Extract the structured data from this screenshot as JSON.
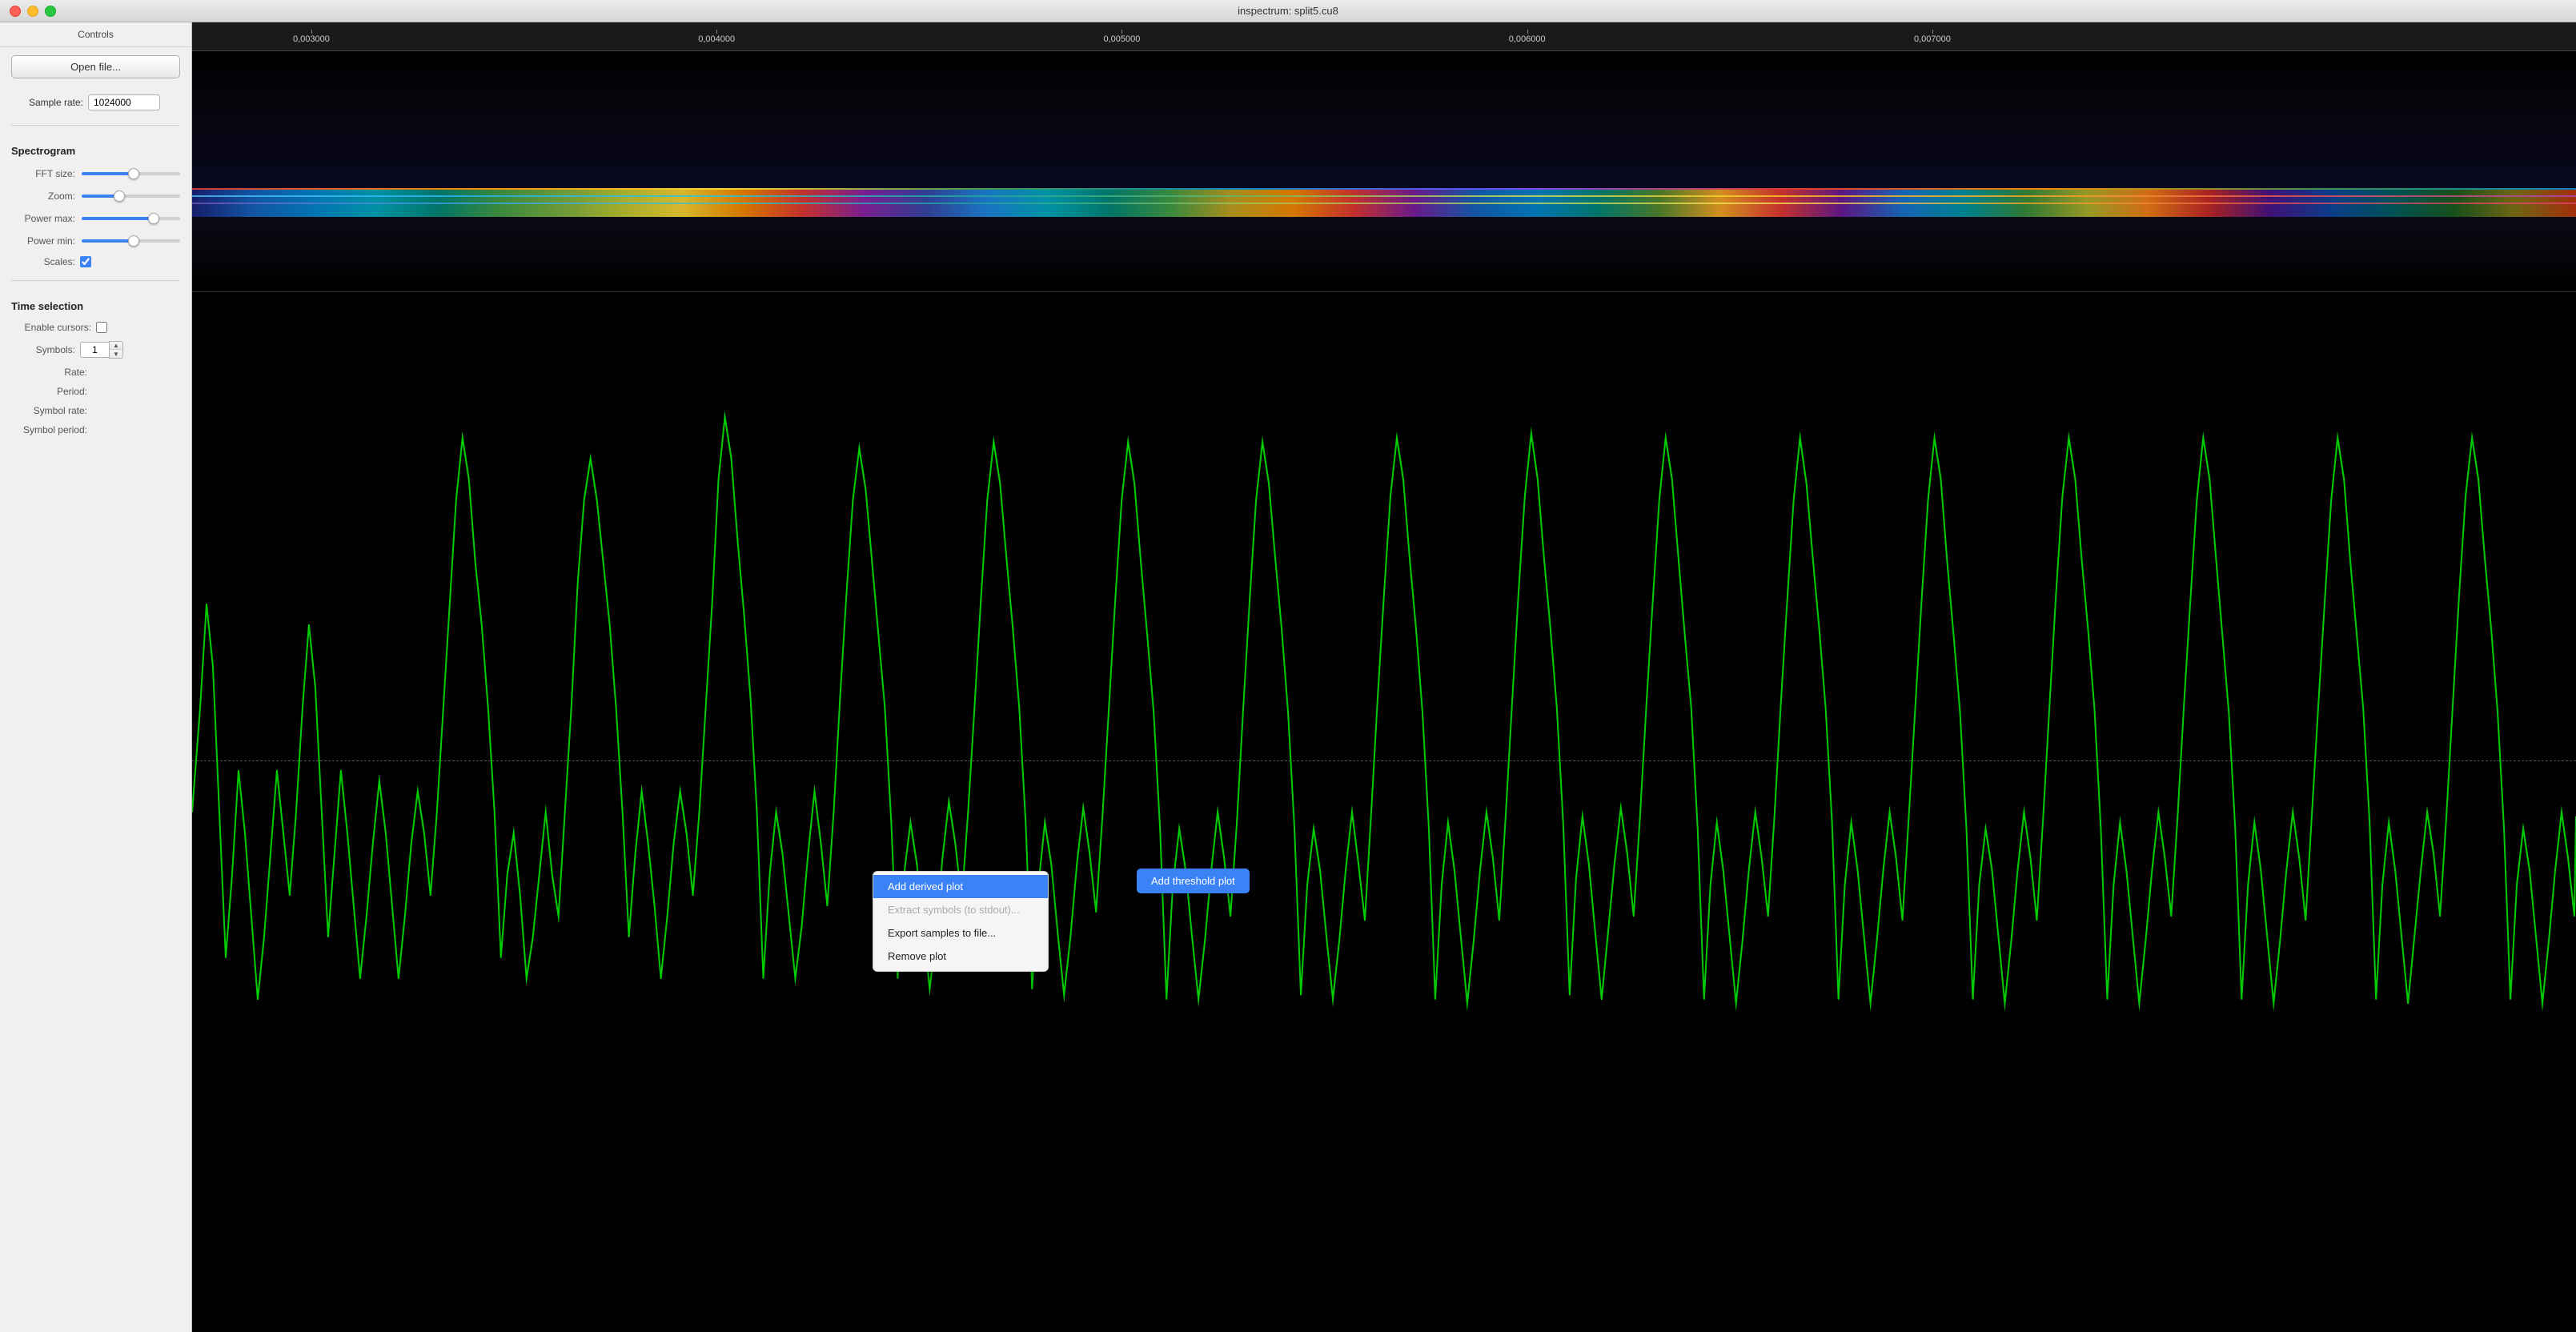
{
  "window": {
    "title": "inspectrum: split5.cu8"
  },
  "traffic_lights": {
    "close": "×",
    "minimize": "–",
    "maximize": "+"
  },
  "sidebar": {
    "header": "Controls",
    "open_file_label": "Open file...",
    "sample_rate_label": "Sample rate:",
    "sample_rate_value": "1024000",
    "spectrogram_section": "Spectrogram",
    "fft_size_label": "FFT size:",
    "zoom_label": "Zoom:",
    "power_max_label": "Power max:",
    "power_min_label": "Power min:",
    "scales_label": "Scales:",
    "scales_checked": true,
    "time_selection_section": "Time selection",
    "enable_cursors_label": "Enable cursors:",
    "enable_cursors_checked": false,
    "symbols_label": "Symbols:",
    "symbols_value": "1",
    "rate_label": "Rate:",
    "rate_value": "",
    "period_label": "Period:",
    "period_value": "",
    "symbol_rate_label": "Symbol rate:",
    "symbol_rate_value": "",
    "symbol_period_label": "Symbol period:",
    "symbol_period_value": ""
  },
  "ruler": {
    "ticks": [
      {
        "label": "0,003000",
        "pct": 5
      },
      {
        "label": "0,004000",
        "pct": 22
      },
      {
        "label": "0,005000",
        "pct": 39
      },
      {
        "label": "0,006000",
        "pct": 56
      },
      {
        "label": "0,007000",
        "pct": 73
      }
    ]
  },
  "context_menu": {
    "items": [
      {
        "label": "Add derived plot",
        "state": "active"
      },
      {
        "label": "Extract symbols (to stdout)...",
        "state": "disabled"
      },
      {
        "label": "Export samples to file...",
        "state": "normal"
      },
      {
        "label": "Remove plot",
        "state": "normal"
      }
    ]
  },
  "submenu": {
    "label": "Add threshold plot"
  }
}
